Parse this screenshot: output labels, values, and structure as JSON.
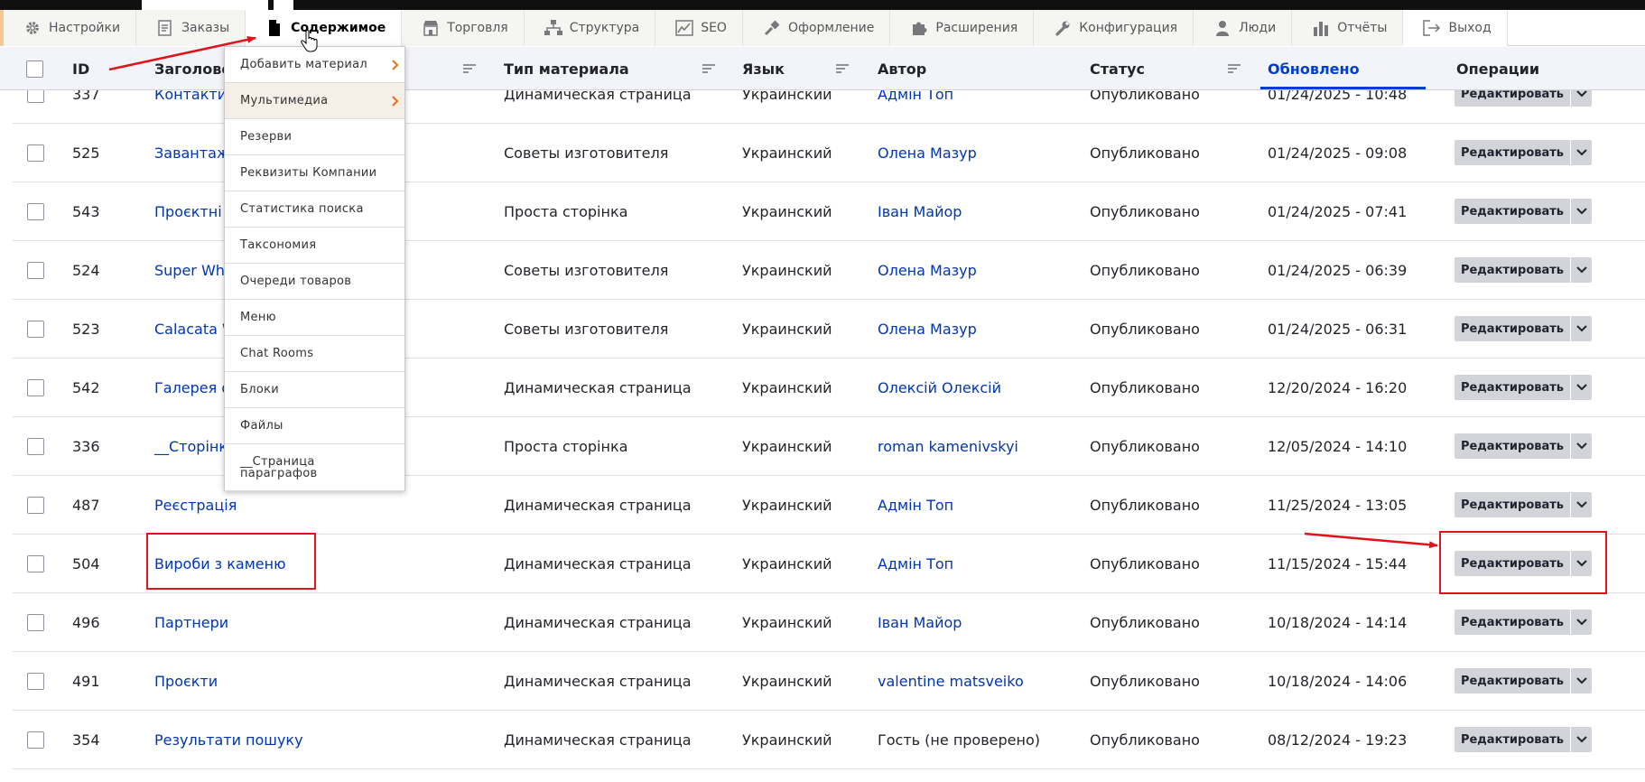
{
  "toolbar": {
    "items": [
      {
        "label": "Настройки",
        "icon": "gear-icon"
      },
      {
        "label": "Заказы",
        "icon": "orders-icon"
      },
      {
        "label": "Содержимое",
        "icon": "file-icon"
      },
      {
        "label": "Торговля",
        "icon": "store-icon"
      },
      {
        "label": "Структура",
        "icon": "sitemap-icon"
      },
      {
        "label": "SEO",
        "icon": "chart-icon"
      },
      {
        "label": "Оформление",
        "icon": "brush-icon"
      },
      {
        "label": "Расширения",
        "icon": "puzzle-icon"
      },
      {
        "label": "Конфигурация",
        "icon": "wrench-icon"
      },
      {
        "label": "Люди",
        "icon": "person-icon"
      },
      {
        "label": "Отчёты",
        "icon": "bar-chart-icon"
      },
      {
        "label": "Выход",
        "icon": "logout-icon"
      }
    ],
    "active": "Содержимое"
  },
  "dropdown": {
    "items": [
      "Добавить материал",
      "Мультимедиа",
      "Резерви",
      "Реквизиты Компании",
      "Статистика поиска",
      "Таксономия",
      "Очереди товаров",
      "Меню",
      "Chat Rooms",
      "Блоки",
      "Файлы",
      "__Страница параграфов"
    ]
  },
  "table": {
    "headers": {
      "id": "ID",
      "title": "Заголовок",
      "type": "Тип материала",
      "language": "Язык",
      "author": "Автор",
      "status": "Статус",
      "updated": "Обновлено",
      "operations": "Операции"
    },
    "edit_label": "Редактировать",
    "rows": [
      {
        "id": "337",
        "title": "Контакти",
        "type": "Динамическая страница",
        "language": "Украинский",
        "author": "Адмін Топ",
        "author_link": true,
        "status": "Опубликовано",
        "updated": "01/24/2025 - 10:48"
      },
      {
        "id": "525",
        "title": "Завантаже",
        "type": "Советы изготовителя",
        "language": "Украинский",
        "author": "Олена Мазур",
        "author_link": true,
        "status": "Опубликовано",
        "updated": "01/24/2025 - 09:08"
      },
      {
        "id": "543",
        "title": "Проєктні з",
        "type": "Проста сторінка",
        "language": "Украинский",
        "author": "Іван Майор",
        "author_link": true,
        "status": "Опубликовано",
        "updated": "01/24/2025 - 07:41"
      },
      {
        "id": "524",
        "title": "Super Whit",
        "type": "Советы изготовителя",
        "language": "Украинский",
        "author": "Олена Мазур",
        "author_link": true,
        "status": "Опубликовано",
        "updated": "01/24/2025 - 06:39"
      },
      {
        "id": "523",
        "title": "Calacata W",
        "type": "Советы изготовителя",
        "language": "Украинский",
        "author": "Олена Мазур",
        "author_link": true,
        "status": "Опубликовано",
        "updated": "01/24/2025 - 06:31"
      },
      {
        "id": "542",
        "title": "Галерея фа",
        "type": "Динамическая страница",
        "language": "Украинский",
        "author": "Олексій Олексій",
        "author_link": true,
        "status": "Опубликовано",
        "updated": "12/20/2024 - 16:20"
      },
      {
        "id": "336",
        "title": "__Сторінка",
        "type": "Проста сторінка",
        "language": "Украинский",
        "author": "roman kamenivskyi",
        "author_link": true,
        "status": "Опубликовано",
        "updated": "12/05/2024 - 14:10"
      },
      {
        "id": "487",
        "title": "Реєстрація",
        "type": "Динамическая страница",
        "language": "Украинский",
        "author": "Адмін Топ",
        "author_link": true,
        "status": "Опубликовано",
        "updated": "11/25/2024 - 13:05"
      },
      {
        "id": "504",
        "title": "Вироби з каменю",
        "type": "Динамическая страница",
        "language": "Украинский",
        "author": "Адмін Топ",
        "author_link": true,
        "status": "Опубликовано",
        "updated": "11/15/2024 - 15:44"
      },
      {
        "id": "496",
        "title": "Партнери",
        "type": "Динамическая страница",
        "language": "Украинский",
        "author": "Іван Майор",
        "author_link": true,
        "status": "Опубликовано",
        "updated": "10/18/2024 - 14:14"
      },
      {
        "id": "491",
        "title": "Проєкти",
        "type": "Динамическая страница",
        "language": "Украинский",
        "author": "valentine matsveiko",
        "author_link": true,
        "status": "Опубликовано",
        "updated": "10/18/2024 - 14:06"
      },
      {
        "id": "354",
        "title": "Результати пошуку",
        "type": "Динамическая страница",
        "language": "Украинский",
        "author": "Гость (не проверено)",
        "author_link": false,
        "status": "Опубликовано",
        "updated": "08/12/2024 - 19:23"
      }
    ]
  },
  "colors": {
    "link": "#0036b1",
    "active_header": "#003ecc",
    "annotation": "#e0131a",
    "button_bg": "#d3d4d9"
  }
}
